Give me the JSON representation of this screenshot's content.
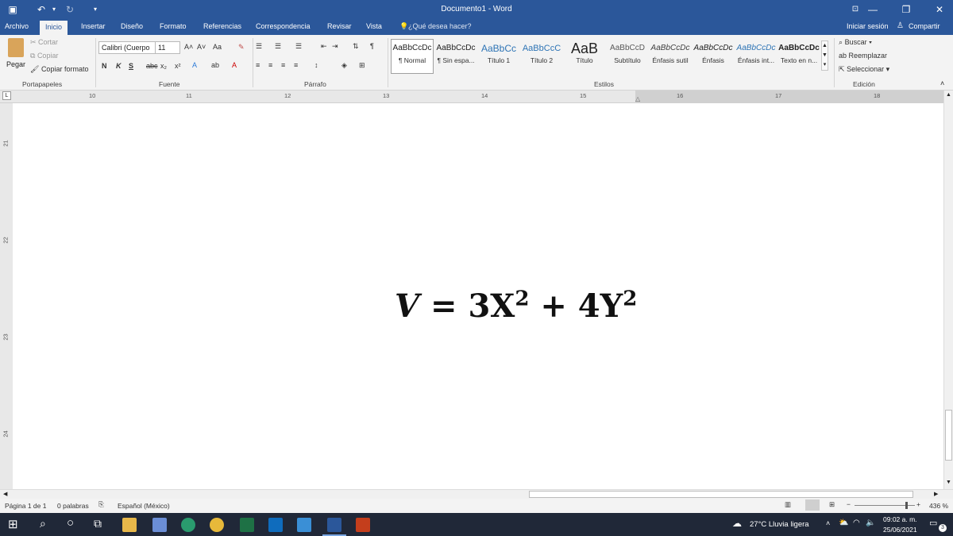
{
  "titlebar": {
    "document_title": "Documento1 - Word"
  },
  "tabs": [
    {
      "label": "Archivo"
    },
    {
      "label": "Inicio"
    },
    {
      "label": "Insertar"
    },
    {
      "label": "Diseño"
    },
    {
      "label": "Formato"
    },
    {
      "label": "Referencias"
    },
    {
      "label": "Correspondencia"
    },
    {
      "label": "Revisar"
    },
    {
      "label": "Vista"
    }
  ],
  "search_tell": "¿Qué desea hacer?",
  "account": {
    "signin": "Iniciar sesión",
    "share": "Compartir"
  },
  "clipboard": {
    "paste": "Pegar",
    "cut": "Cortar",
    "copy": "Copiar",
    "format_painter": "Copiar formato",
    "label": "Portapapeles"
  },
  "font": {
    "name": "Calibri (Cuerpo",
    "size": "11",
    "aa": "Aa",
    "label": "Fuente",
    "bold": "N",
    "italic": "K",
    "underline": "S",
    "strike": "abc",
    "sub": "x₂",
    "sup": "x²"
  },
  "paragraph": {
    "label": "Párrafo"
  },
  "styles": {
    "label": "Estilos",
    "items": [
      {
        "sample": "AaBbCcDc",
        "name": "¶ Normal"
      },
      {
        "sample": "AaBbCcDc",
        "name": "¶ Sin espa..."
      },
      {
        "sample": "AaBbCc",
        "name": "Título 1"
      },
      {
        "sample": "AaBbCcC",
        "name": "Título 2"
      },
      {
        "sample": "AaB",
        "name": "Título"
      },
      {
        "sample": "AaBbCcD",
        "name": "Subtítulo"
      },
      {
        "sample": "AaBbCcDc",
        "name": "Énfasis sutil"
      },
      {
        "sample": "AaBbCcDc",
        "name": "Énfasis"
      },
      {
        "sample": "AaBbCcDc",
        "name": "Énfasis int..."
      },
      {
        "sample": "AaBbCcDc",
        "name": "Texto en n..."
      }
    ]
  },
  "editing": {
    "find": "Buscar",
    "replace": "Reemplazar",
    "select": "Seleccionar",
    "label": "Edición"
  },
  "ruler": {
    "h": [
      "10",
      "11",
      "12",
      "13",
      "14",
      "15",
      "16",
      "17",
      "18"
    ],
    "v": [
      "21",
      "22",
      "23",
      "24"
    ]
  },
  "document": {
    "eq_lhs": "V",
    "eq_eq": "=",
    "eq_t1": "3X",
    "eq_e1": "2",
    "eq_plus": "+",
    "eq_t2": "4Y",
    "eq_e2": "2"
  },
  "status": {
    "page": "Página 1 de 1",
    "words": "0 palabras",
    "language": "Español (México)",
    "zoom": "436 %"
  },
  "taskbar": {
    "weather": "27°C  Lluvia ligera",
    "time": "09:02 a. m.",
    "date": "25/06/2021",
    "notif": "3"
  }
}
